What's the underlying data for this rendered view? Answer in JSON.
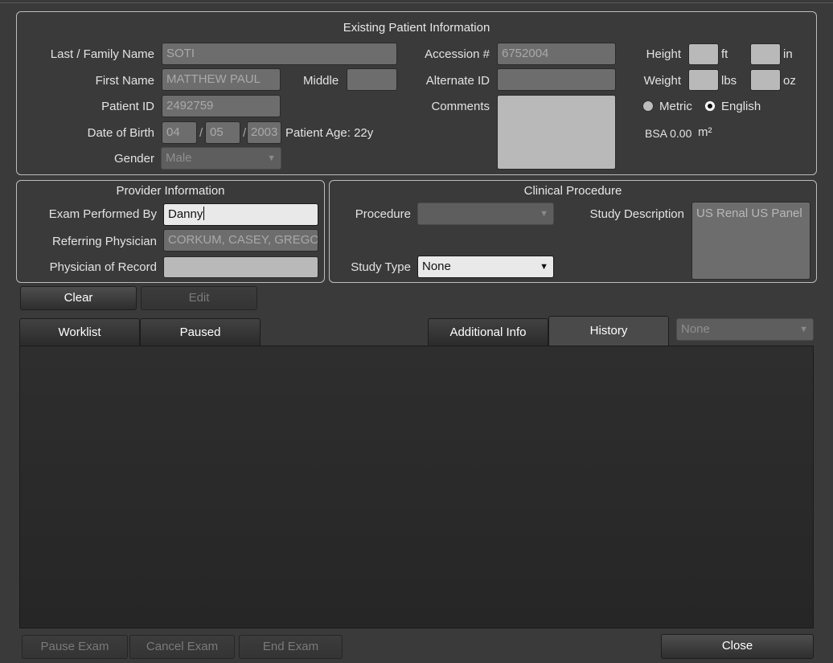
{
  "existing_patient": {
    "title": "Existing Patient Information",
    "last_name_label": "Last / Family Name",
    "last_name_value": "SOTI",
    "first_name_label": "First Name",
    "first_name_value": "MATTHEW PAUL",
    "middle_label": "Middle",
    "middle_value": "",
    "patient_id_label": "Patient ID",
    "patient_id_value": "2492759",
    "dob_label": "Date of Birth",
    "dob_month": "04",
    "dob_day": "05",
    "dob_year": "2003",
    "dob_sep": "/",
    "age_text": "Patient Age: 22y",
    "gender_label": "Gender",
    "gender_value": "Male",
    "accession_label": "Accession #",
    "accession_value": "6752004",
    "alternate_id_label": "Alternate ID",
    "alternate_id_value": "",
    "comments_label": "Comments",
    "comments_value": "",
    "height_label": "Height",
    "height_ft_unit": "ft",
    "height_in_unit": "in",
    "weight_label": "Weight",
    "weight_lbs_unit": "lbs",
    "weight_oz_unit": "oz",
    "metric_label": "Metric",
    "english_label": "English",
    "unit_system_selected": "English",
    "bsa_text": "BSA 0.00",
    "bsa_unit": "m²"
  },
  "provider": {
    "title": "Provider Information",
    "exam_performed_by_label": "Exam Performed By",
    "exam_performed_by_value": "Danny",
    "referring_physician_label": "Referring Physician",
    "referring_physician_value": "CORKUM, CASEY, GREGORY",
    "physician_of_record_label": "Physician of Record",
    "physician_of_record_value": ""
  },
  "clinical": {
    "title": "Clinical Procedure",
    "procedure_label": "Procedure",
    "procedure_value": "",
    "study_type_label": "Study Type",
    "study_type_value": "None",
    "study_description_label": "Study Description",
    "study_description_value": "US Renal US Panel"
  },
  "actions": {
    "clear": "Clear",
    "edit": "Edit"
  },
  "tabs": {
    "worklist": "Worklist",
    "paused": "Paused",
    "additional_info": "Additional Info",
    "history": "History",
    "active_tab": "History",
    "history_filter_value": "None"
  },
  "footer": {
    "pause_exam": "Pause Exam",
    "cancel_exam": "Cancel Exam",
    "end_exam": "End Exam",
    "close": "Close"
  },
  "icons": {
    "dropdown_caret": "▼"
  }
}
